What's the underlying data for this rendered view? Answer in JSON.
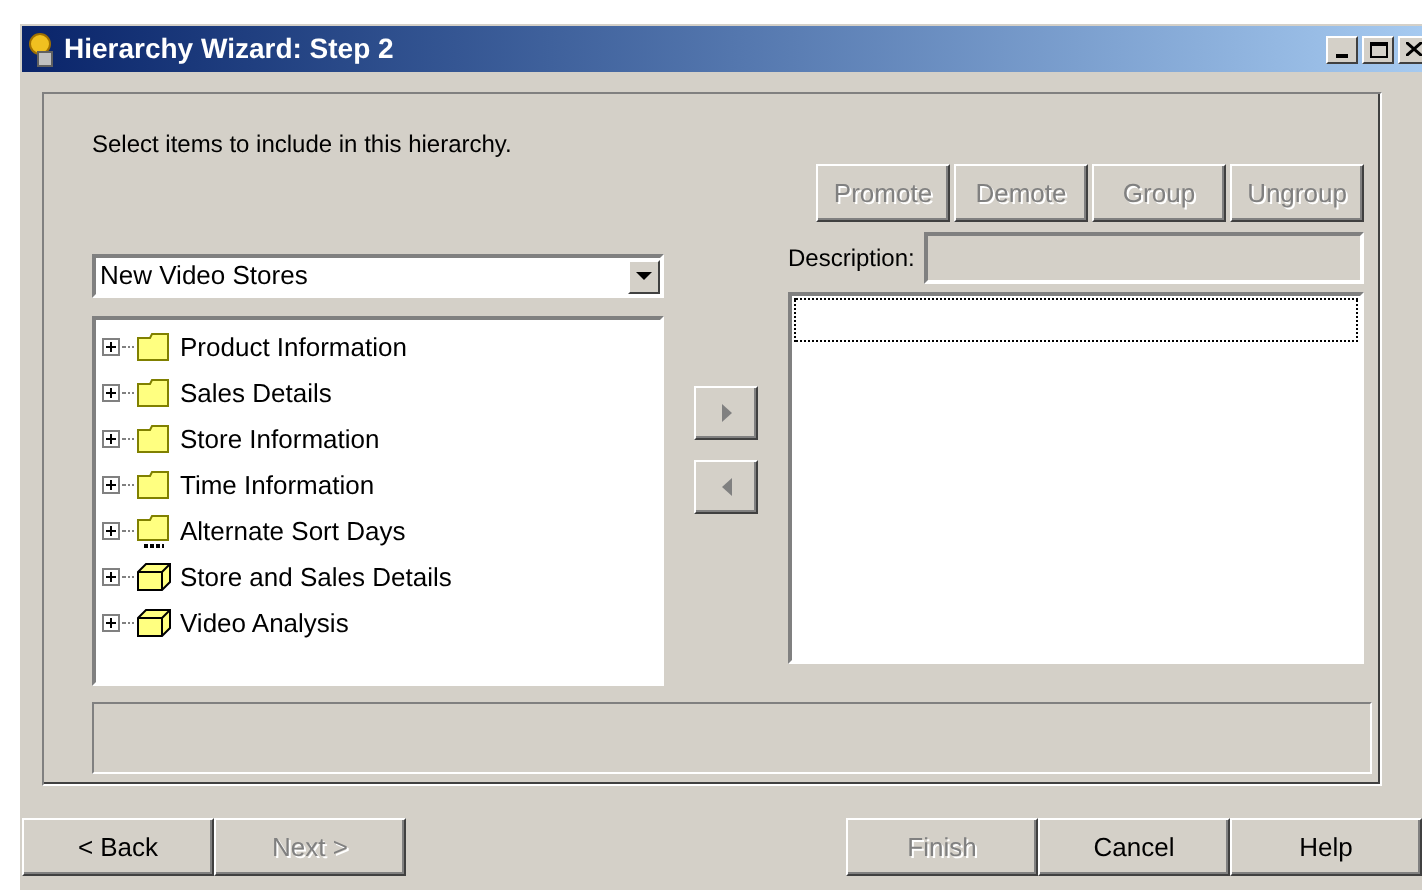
{
  "window": {
    "title": "Hierarchy Wizard: Step 2"
  },
  "instruction": "Select items to include in this hierarchy.",
  "source": {
    "value": "New Video Stores"
  },
  "tree": [
    {
      "label": "Product Information",
      "kind": "folder",
      "expanded": false
    },
    {
      "label": "Sales Details",
      "kind": "folder",
      "expanded": false
    },
    {
      "label": "Store Information",
      "kind": "folder",
      "expanded": false
    },
    {
      "label": "Time Information",
      "kind": "folder",
      "expanded": false
    },
    {
      "label": "Alternate Sort Days",
      "kind": "sql",
      "expanded": false
    },
    {
      "label": "Store and Sales Details",
      "kind": "cube",
      "expanded": false
    },
    {
      "label": "Video Analysis",
      "kind": "cube",
      "expanded": false
    }
  ],
  "move_buttons": [
    {
      "kind": "add",
      "disabled": true
    },
    {
      "kind": "remove",
      "disabled": true
    }
  ],
  "hierarchy_buttons": [
    {
      "label": "Promote",
      "disabled": true
    },
    {
      "label": "Demote",
      "disabled": true
    },
    {
      "label": "Group",
      "disabled": true
    },
    {
      "label": "Ungroup",
      "disabled": true
    }
  ],
  "description": {
    "label": "Description:"
  },
  "footer_buttons": [
    {
      "label": "< Back",
      "disabled": false
    },
    {
      "label": "Next >",
      "disabled": true
    },
    {
      "label": "Finish",
      "disabled": true
    },
    {
      "label": "Cancel",
      "disabled": false
    },
    {
      "label": "Help",
      "disabled": false
    }
  ]
}
